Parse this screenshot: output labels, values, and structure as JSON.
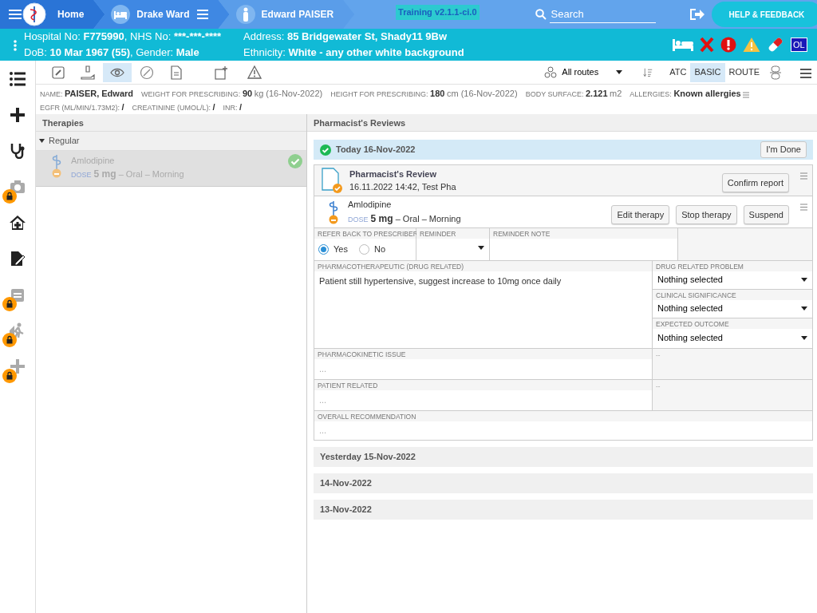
{
  "topbar": {
    "crumbs": [
      {
        "label": "Home"
      },
      {
        "label": "Drake Ward"
      },
      {
        "label": "Edward PAISER"
      }
    ],
    "version": "Training v2.1.1-ci.0",
    "search": {
      "placeholder": "Search"
    },
    "help_button": "HELP & FEEDBACK"
  },
  "patient_banner": {
    "lines": [
      [
        {
          "label": "Hospital No:",
          "value": "F775990"
        },
        {
          "label": ", NHS No:",
          "value": "***-***-****"
        }
      ],
      [
        {
          "label": "DoB:",
          "value": "10 Mar 1967 (55)"
        },
        {
          "label": ", Gender:",
          "value": "Male"
        }
      ],
      [
        {
          "label": "Address:",
          "value": "85 Bridgewater St, Shady11 9Bw"
        }
      ],
      [
        {
          "label": "Ethnicity:",
          "value": "White - any other white background"
        }
      ]
    ],
    "alert_badge": "OL"
  },
  "nav": [
    {
      "locked": false
    },
    {
      "locked": false
    },
    {
      "locked": false
    },
    {
      "locked": true
    },
    {
      "locked": false
    },
    {
      "locked": false
    },
    {
      "locked": true
    },
    {
      "locked": true
    },
    {
      "locked": true
    }
  ],
  "toolbar": {
    "tools": [
      {
        "selected": false
      },
      {
        "selected": false
      },
      {
        "selected": true
      },
      {
        "selected": false
      },
      {
        "selected": false
      },
      {
        "selected": false
      },
      {
        "selected": false
      }
    ],
    "routes": {
      "value": "All routes"
    },
    "views": [
      {
        "label": "ATC",
        "selected": false
      },
      {
        "label": "BASIC",
        "selected": true
      },
      {
        "label": "ROUTE",
        "selected": false
      }
    ]
  },
  "patient_info": [
    {
      "label": "NAME:",
      "value": "PAISER, Edward"
    },
    {
      "label": "WEIGHT FOR PRESCRIBING:",
      "value": "90",
      "extra": "kg (16-Nov-2022)"
    },
    {
      "label": "HEIGHT FOR PRESCRIBING:",
      "value": "180",
      "extra": "cm (16-Nov-2022)"
    },
    {
      "label": "BODY SURFACE:",
      "value": "2.121",
      "extra": "m2"
    },
    {
      "label": "ALLERGIES:",
      "value": "Known allergies",
      "kind": "menu"
    },
    {
      "label": "EGFR (ML/MIN/1.73M2):",
      "value": "/"
    },
    {
      "label": "CREATININE (UMOL/L):",
      "value": "/"
    },
    {
      "label": "INR:",
      "value": "/"
    }
  ],
  "therapies": {
    "title": "Therapies",
    "groups": [
      {
        "label": "Regular",
        "expanded": true,
        "items": [
          {
            "name": "Amlodipine",
            "dose_label": "DOSE",
            "dose": "5 mg",
            "details": "– Oral – Morning",
            "selected": true,
            "reviewed": true
          }
        ]
      }
    ]
  },
  "reviews": {
    "title": "Pharmacist's Reviews",
    "days": [
      {
        "title": "Today 16-Nov-2022",
        "expanded": true,
        "done": true,
        "done_button": "I'm Done",
        "review": {
          "title": "Pharmacist's Review",
          "meta": "16.11.2022 14:42, Test Pha",
          "confirm_button": "Confirm report",
          "therapy": {
            "name": "Amlodipine",
            "dose_label": "DOSE",
            "dose": "5 mg",
            "details": "– Oral – Morning",
            "actions": [
              "Edit therapy",
              "Stop therapy",
              "Suspend"
            ]
          },
          "refer": {
            "label": "REFER BACK TO PRESCRIBER",
            "options": [
              {
                "label": "Yes",
                "selected": true
              },
              {
                "label": "No",
                "selected": false
              }
            ]
          },
          "reminder": {
            "label": "REMINDER"
          },
          "reminder_note": {
            "label": "REMINDER NOTE"
          },
          "pharmacotherapeutic": {
            "label": "PHARMACOTHERAPEUTIC (DRUG RELATED)",
            "value": "Patient still hypertensive, suggest increase to 10mg once daily"
          },
          "selects": [
            {
              "label": "DRUG RELATED PROBLEM",
              "value": "Nothing selected"
            },
            {
              "label": "CLINICAL SIGNIFICANCE",
              "value": "Nothing selected"
            },
            {
              "label": "EXPECTED OUTCOME",
              "value": "Nothing selected"
            }
          ],
          "notes": [
            {
              "label": "PHARMACOKINETIC ISSUE",
              "placeholder": "...",
              "side": "--"
            },
            {
              "label": "PATIENT RELATED",
              "placeholder": "...",
              "side": "--"
            }
          ],
          "overall": {
            "label": "OVERALL RECOMMENDATION",
            "placeholder": "..."
          }
        }
      },
      {
        "title": "Yesterday 15-Nov-2022",
        "expanded": false
      },
      {
        "title": "14-Nov-2022",
        "expanded": false
      },
      {
        "title": "13-Nov-2022",
        "expanded": false
      }
    ]
  }
}
